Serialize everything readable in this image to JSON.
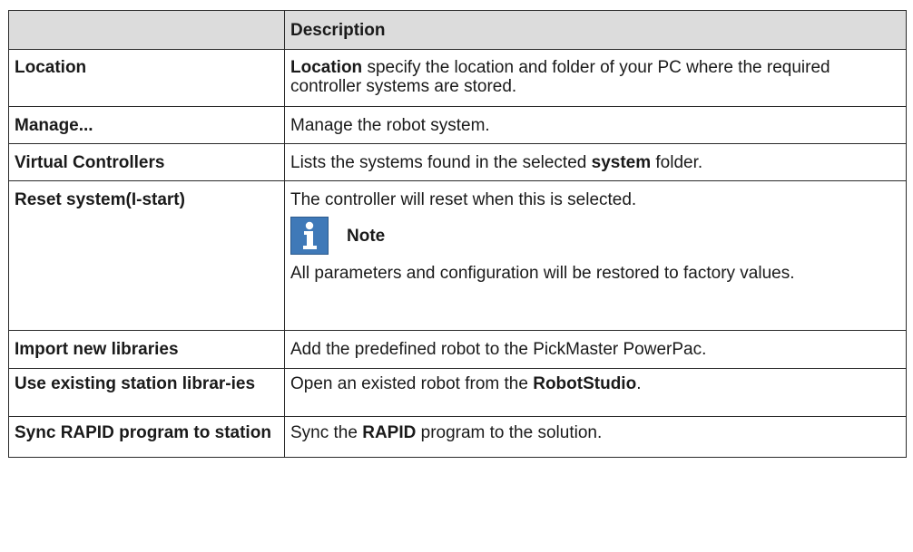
{
  "table": {
    "header": {
      "col1": "",
      "col2": "Description"
    },
    "rows": {
      "location": {
        "name": "Location",
        "desc_bold": "Location",
        "desc_text": " specify the location and folder of your PC where the required controller systems are stored."
      },
      "manage": {
        "name": "Manage...",
        "desc_text": "Manage the robot system."
      },
      "virtual": {
        "name": "Virtual Controllers",
        "desc_pre": "Lists the systems found in the selected ",
        "desc_bold": "system",
        "desc_post": " folder."
      },
      "reset": {
        "name": "Reset system(I-start)",
        "desc_text": "The controller will reset when this is selected.",
        "note_label": "Note",
        "note_icon": "info-icon",
        "note_text": "All parameters and configuration will be restored to factory values."
      },
      "import": {
        "name": "Import new libraries",
        "desc_text": "Add the predefined robot to the PickMaster PowerPac."
      },
      "existing": {
        "name": "Use existing station librar-ies",
        "desc_pre": "Open an existed robot from the ",
        "desc_bold": "RobotStudio",
        "desc_post": "."
      },
      "sync": {
        "name": "Sync RAPID program to station",
        "desc_pre": "Sync the ",
        "desc_bold": "RAPID",
        "desc_post": " program to the solution."
      }
    }
  },
  "colors": {
    "header_bg": "#dcdcdc",
    "note_icon_bg": "#3f79b8"
  }
}
